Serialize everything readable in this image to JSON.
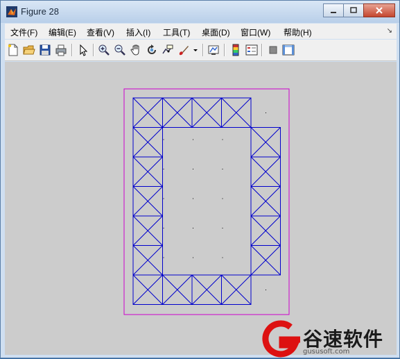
{
  "window": {
    "title": "Figure 28"
  },
  "menu": [
    {
      "label": "文件(F)"
    },
    {
      "label": "编辑(E)"
    },
    {
      "label": "查看(V)"
    },
    {
      "label": "插入(I)"
    },
    {
      "label": "工具(T)"
    },
    {
      "label": "桌面(D)"
    },
    {
      "label": "窗口(W)"
    },
    {
      "label": "帮助(H)"
    }
  ],
  "toolbar": [
    {
      "icon": "new-file-icon"
    },
    {
      "icon": "open-folder-icon"
    },
    {
      "icon": "save-icon"
    },
    {
      "icon": "print-icon"
    },
    {
      "icon": "pointer-icon"
    },
    {
      "icon": "zoom-in-icon"
    },
    {
      "icon": "zoom-out-icon"
    },
    {
      "icon": "pan-hand-icon"
    },
    {
      "icon": "rotate-3d-icon"
    },
    {
      "icon": "data-cursor-icon"
    },
    {
      "icon": "brush-icon"
    },
    {
      "icon": "brush-dropdown-icon"
    },
    {
      "icon": "link-plot-icon"
    },
    {
      "icon": "colorbar-icon"
    },
    {
      "icon": "legend-icon"
    },
    {
      "icon": "hide-plot-tools-icon"
    },
    {
      "icon": "show-plot-tools-icon"
    }
  ],
  "colors": {
    "truss": "#0000cc",
    "boundary": "#cc00cc",
    "background": "#cccccc"
  },
  "plot": {
    "description_free": true,
    "grid_cols": 5,
    "grid_rows": 7,
    "cell_w": 42.5,
    "cell_h": 42.5
  },
  "watermark": {
    "text": "谷速软件",
    "sub": "gususoft.com"
  }
}
